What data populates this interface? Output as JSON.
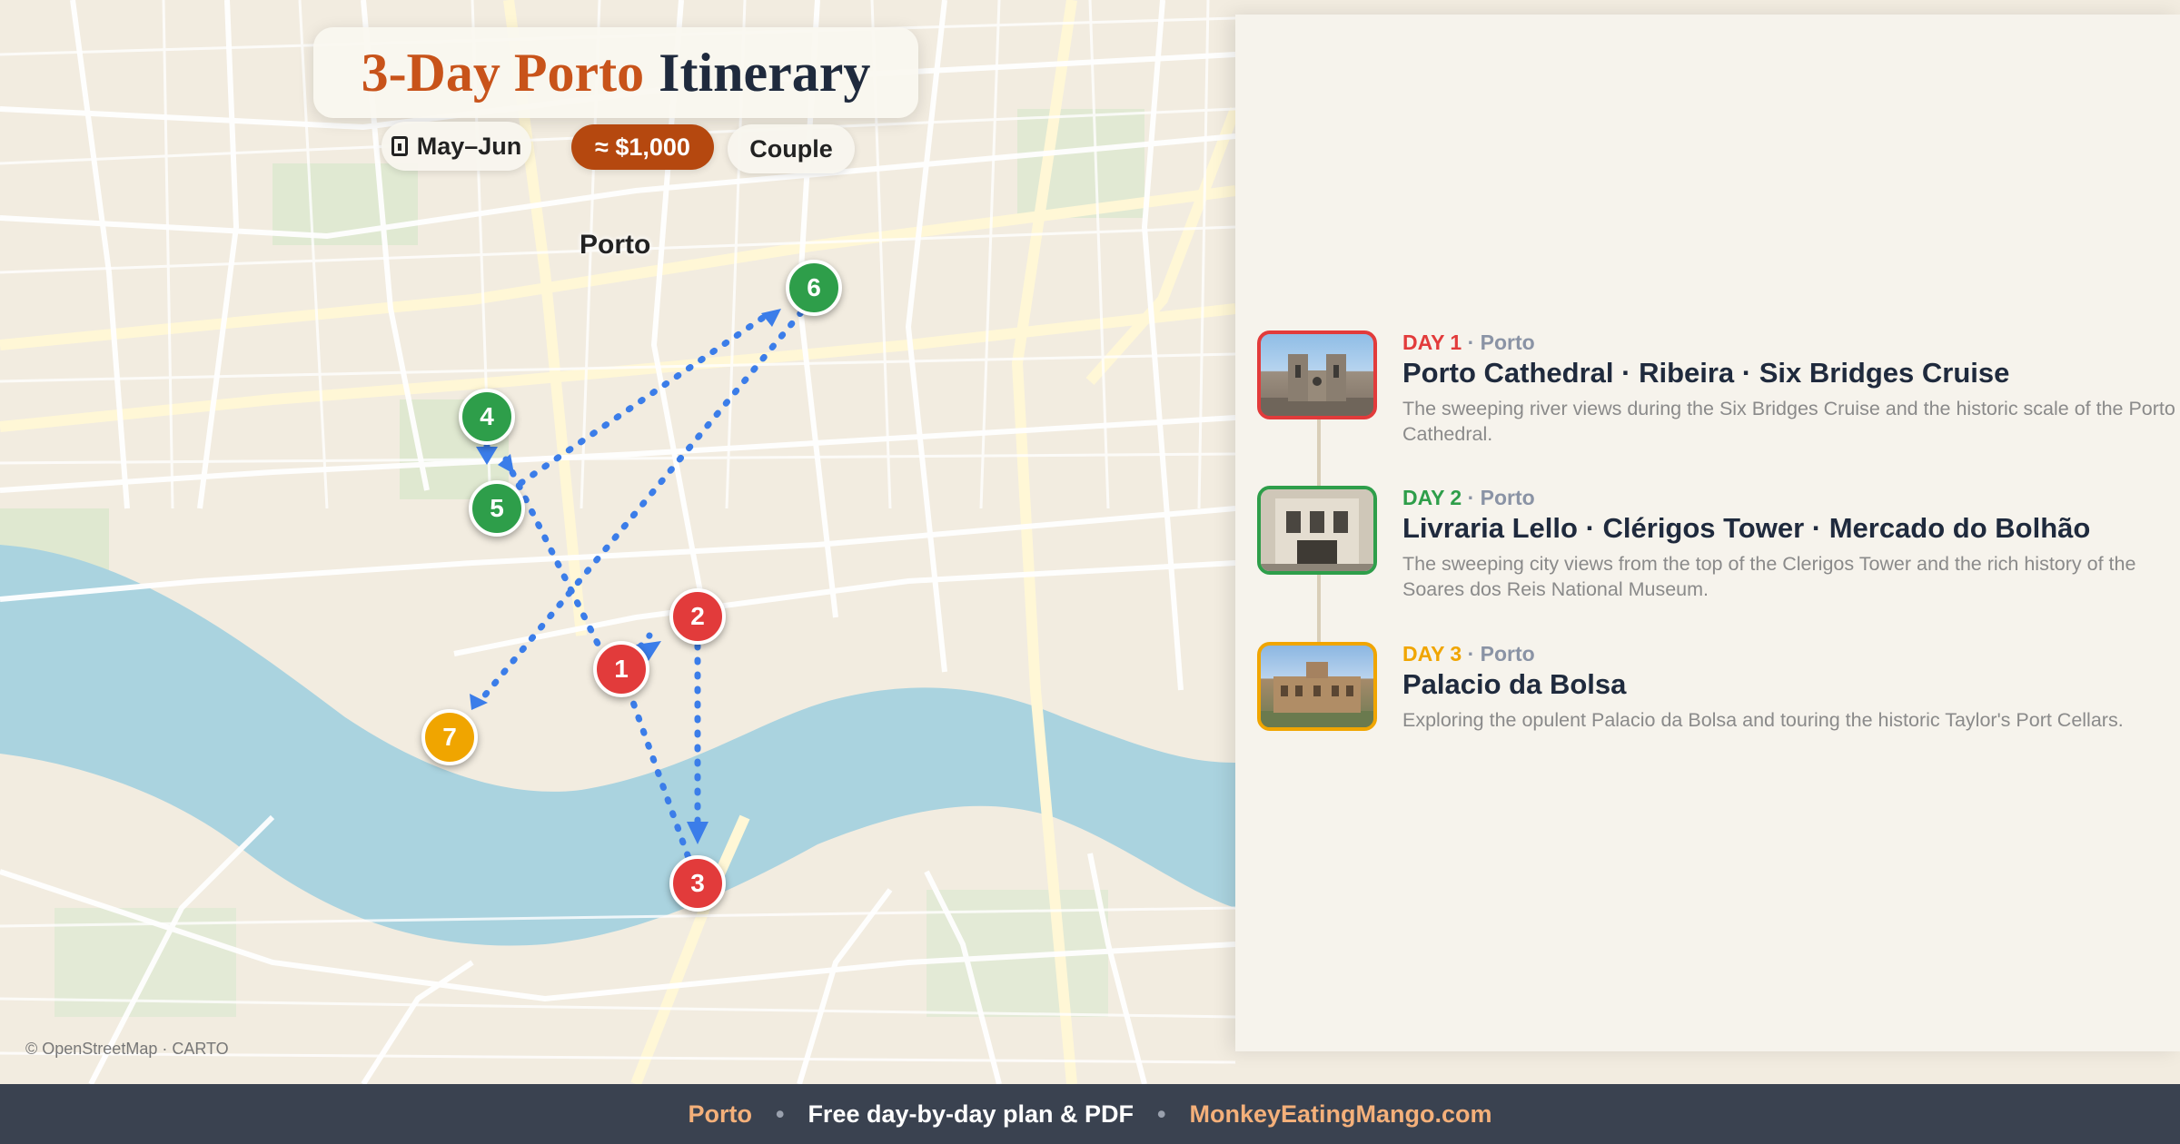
{
  "header": {
    "title_part1": "3-Day Porto",
    "title_part2": "Itinerary",
    "season": "May–Jun",
    "season_icon": "calendar-icon",
    "budget": "≈ $1,000",
    "travelers": "Couple"
  },
  "map": {
    "place_label": "Porto",
    "attribution": "© OpenStreetMap · CARTO",
    "markers": [
      {
        "label": "1",
        "day": 1
      },
      {
        "label": "2",
        "day": 1
      },
      {
        "label": "3",
        "day": 1
      },
      {
        "label": "4",
        "day": 2
      },
      {
        "label": "5",
        "day": 2
      },
      {
        "label": "6",
        "day": 2
      },
      {
        "label": "7",
        "day": 3
      }
    ]
  },
  "days": [
    {
      "label": "DAY 1",
      "place": "· Porto",
      "color": "#e23b3b",
      "title": "Porto Cathedral · Ribeira · Six Bridges Cruise",
      "description": "The sweeping river views during the Six Bridges Cruise and the historic scale of the Porto Cathedral."
    },
    {
      "label": "DAY 2",
      "place": "· Porto",
      "color": "#2e9e4a",
      "title": "Livraria Lello · Clérigos Tower · Mercado do Bolhão",
      "description": "The sweeping city views from the top of the Clerigos Tower and the rich history of the Soares dos Reis National Museum."
    },
    {
      "label": "DAY 3",
      "place": "· Porto",
      "color": "#f0a500",
      "title": "Palacio da Bolsa",
      "description": "Exploring the opulent Palacio da Bolsa and touring the historic Taylor's Port Cellars."
    }
  ],
  "footer": {
    "city": "Porto",
    "separator": "•",
    "tagline": "Free day-by-day plan & PDF",
    "site": "MonkeyEatingMango.com"
  }
}
